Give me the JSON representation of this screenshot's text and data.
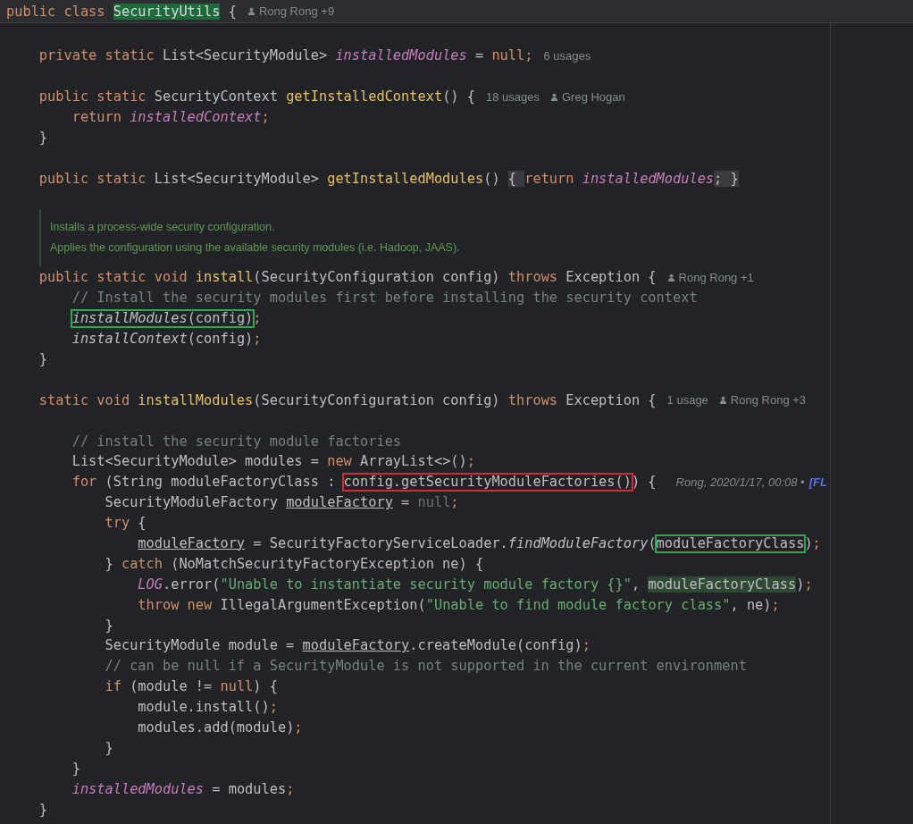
{
  "sticky_header": {
    "tokens": [
      {
        "kind": "kw",
        "text": "public class "
      },
      {
        "kind": "match",
        "text": "SecurityUtils"
      },
      {
        "kind": "plain",
        "text": " {"
      }
    ],
    "hints": [
      {
        "kind": "author",
        "text": "Rong Rong +9"
      }
    ]
  },
  "editor": {
    "blocks": [
      {
        "kind": "blank"
      },
      {
        "kind": "line",
        "tokens": [
          {
            "kind": "kw",
            "text": "    private static "
          },
          {
            "kind": "plain",
            "text": "List<SecurityModule> "
          },
          {
            "kind": "field",
            "text": "installedModules"
          },
          {
            "kind": "plain",
            "text": " = "
          },
          {
            "kind": "kw",
            "text": "null;"
          }
        ],
        "hints": [
          {
            "kind": "usages",
            "text": "6 usages"
          }
        ]
      },
      {
        "kind": "blank"
      },
      {
        "kind": "line",
        "tokens": [
          {
            "kind": "kw",
            "text": "    public static "
          },
          {
            "kind": "plain",
            "text": "SecurityContext "
          },
          {
            "kind": "decl",
            "text": "getInstalledContext"
          },
          {
            "kind": "plain",
            "text": "() {"
          }
        ],
        "hints": [
          {
            "kind": "usages",
            "text": "18 usages"
          },
          {
            "kind": "author",
            "text": "Greg Hogan"
          }
        ]
      },
      {
        "kind": "line",
        "tokens": [
          {
            "kind": "kw",
            "text": "        return "
          },
          {
            "kind": "field",
            "text": "installedContext"
          },
          {
            "kind": "semi",
            "text": ";"
          }
        ]
      },
      {
        "kind": "line",
        "tokens": [
          {
            "kind": "plain",
            "text": "    }"
          }
        ]
      },
      {
        "kind": "blank"
      },
      {
        "kind": "line",
        "tokens": [
          {
            "kind": "kw",
            "text": "    public static "
          },
          {
            "kind": "plain",
            "text": "List<SecurityModule> "
          },
          {
            "kind": "decl",
            "text": "getInstalledModules"
          },
          {
            "kind": "plain",
            "text": "() "
          },
          {
            "kind": "fold",
            "text": "{ "
          },
          {
            "kind": "kw",
            "text": "return "
          },
          {
            "kind": "field",
            "text": "installedModules"
          },
          {
            "kind": "fold",
            "text": "; }"
          }
        ]
      },
      {
        "kind": "blank"
      },
      {
        "kind": "doc",
        "lines": [
          "Installs a process-wide security configuration.",
          "Applies the configuration using the available security modules (i.e. Hadoop, JAAS)."
        ]
      },
      {
        "kind": "line",
        "tokens": [
          {
            "kind": "kw",
            "text": "    public static void "
          },
          {
            "kind": "decl",
            "text": "install"
          },
          {
            "kind": "plain",
            "text": "(SecurityConfiguration config) "
          },
          {
            "kind": "kw",
            "text": "throws "
          },
          {
            "kind": "plain",
            "text": "Exception {"
          }
        ],
        "hints": [
          {
            "kind": "author",
            "text": "Rong Rong +1"
          }
        ]
      },
      {
        "kind": "line",
        "tokens": [
          {
            "kind": "comment",
            "text": "        // Install the security modules first before installing the security context"
          }
        ]
      },
      {
        "kind": "line",
        "tokens": [
          {
            "kind": "boxed",
            "color": "#2fa84f",
            "tokens": [
              {
                "kind": "call",
                "text": "        installModules"
              },
              {
                "kind": "plain",
                "text": "(config)"
              }
            ]
          },
          {
            "kind": "semi",
            "text": ";"
          }
        ]
      },
      {
        "kind": "line",
        "tokens": [
          {
            "kind": "call",
            "text": "        installContext"
          },
          {
            "kind": "plain",
            "text": "(config)"
          },
          {
            "kind": "semi",
            "text": ";"
          }
        ]
      },
      {
        "kind": "line",
        "tokens": [
          {
            "kind": "plain",
            "text": "    }"
          }
        ]
      },
      {
        "kind": "blank"
      },
      {
        "kind": "line",
        "tokens": [
          {
            "kind": "kw",
            "text": "    static void "
          },
          {
            "kind": "decl",
            "text": "installModules"
          },
          {
            "kind": "plain",
            "text": "(SecurityConfiguration config) "
          },
          {
            "kind": "kw",
            "text": "throws "
          },
          {
            "kind": "plain",
            "text": "Exception {"
          }
        ],
        "hints": [
          {
            "kind": "usages",
            "text": "1 usage"
          },
          {
            "kind": "author",
            "text": "Rong Rong +3"
          }
        ]
      },
      {
        "kind": "blank"
      },
      {
        "kind": "line",
        "tokens": [
          {
            "kind": "comment",
            "text": "        // install the security module factories"
          }
        ]
      },
      {
        "kind": "line",
        "tokens": [
          {
            "kind": "plain",
            "text": "        List<SecurityModule> modules = "
          },
          {
            "kind": "kw",
            "text": "new "
          },
          {
            "kind": "plain",
            "text": "ArrayList<>()"
          },
          {
            "kind": "semi",
            "text": ";"
          }
        ]
      },
      {
        "kind": "line",
        "tokens": [
          {
            "kind": "kw",
            "text": "        for "
          },
          {
            "kind": "plain",
            "text": "(String moduleFactoryClass : "
          },
          {
            "kind": "boxed",
            "color": "#e0262c",
            "tokens": [
              {
                "kind": "plain",
                "text": "config.getSecurityModuleFactories()"
              }
            ]
          },
          {
            "kind": "plain",
            "text": ") {"
          }
        ],
        "hints": [
          {
            "kind": "blame",
            "text": "Rong, 2020/1/17, 00:08 •"
          },
          {
            "kind": "link",
            "text": "[FL"
          }
        ]
      },
      {
        "kind": "line",
        "tokens": [
          {
            "kind": "plain",
            "text": "            SecurityModuleFactory "
          },
          {
            "kind": "under",
            "text": "moduleFactory"
          },
          {
            "kind": "plain",
            "text": " = "
          },
          {
            "kind": "dim",
            "text": "null"
          },
          {
            "kind": "semi",
            "text": ";"
          }
        ]
      },
      {
        "kind": "line",
        "tokens": [
          {
            "kind": "kw",
            "text": "            try "
          },
          {
            "kind": "plain",
            "text": "{"
          }
        ]
      },
      {
        "kind": "line",
        "tokens": [
          {
            "kind": "under",
            "text": "                moduleFactory"
          },
          {
            "kind": "plain",
            "text": " = SecurityFactoryServiceLoader."
          },
          {
            "kind": "call",
            "text": "findModuleFactory"
          },
          {
            "kind": "plain",
            "text": "("
          },
          {
            "kind": "boxed",
            "color": "#2fa84f",
            "tokens": [
              {
                "kind": "plain",
                "text": "moduleFactoryClass"
              }
            ]
          },
          {
            "kind": "plain",
            "text": ")"
          },
          {
            "kind": "semi",
            "text": ";"
          }
        ]
      },
      {
        "kind": "line",
        "tokens": [
          {
            "kind": "plain",
            "text": "            } "
          },
          {
            "kind": "kw",
            "text": "catch "
          },
          {
            "kind": "plain",
            "text": "(NoMatchSecurityFactoryException ne) {"
          }
        ]
      },
      {
        "kind": "line",
        "tokens": [
          {
            "kind": "field",
            "text": "                LOG"
          },
          {
            "kind": "plain",
            "text": ".error("
          },
          {
            "kind": "string",
            "text": "\"Unable to instantiate security module factory {}\""
          },
          {
            "kind": "plain",
            "text": ", "
          },
          {
            "kind": "match",
            "text": "moduleFactoryClass"
          },
          {
            "kind": "plain",
            "text": ")"
          },
          {
            "kind": "semi",
            "text": ";"
          }
        ]
      },
      {
        "kind": "line",
        "tokens": [
          {
            "kind": "kw",
            "text": "                throw new "
          },
          {
            "kind": "plain",
            "text": "IllegalArgumentException("
          },
          {
            "kind": "string",
            "text": "\"Unable to find module factory class\""
          },
          {
            "kind": "plain",
            "text": ", ne)"
          },
          {
            "kind": "semi",
            "text": ";"
          }
        ]
      },
      {
        "kind": "line",
        "tokens": [
          {
            "kind": "plain",
            "text": "            }"
          }
        ]
      },
      {
        "kind": "line",
        "tokens": [
          {
            "kind": "plain",
            "text": "            SecurityModule module = "
          },
          {
            "kind": "under",
            "text": "moduleFactory"
          },
          {
            "kind": "plain",
            "text": ".createModule(config)"
          },
          {
            "kind": "semi",
            "text": ";"
          }
        ]
      },
      {
        "kind": "line",
        "tokens": [
          {
            "kind": "comment",
            "text": "            // can be null if a SecurityModule is not supported in the current environment"
          }
        ]
      },
      {
        "kind": "line",
        "tokens": [
          {
            "kind": "kw",
            "text": "            if "
          },
          {
            "kind": "plain",
            "text": "(module != "
          },
          {
            "kind": "kw",
            "text": "null"
          },
          {
            "kind": "plain",
            "text": ") {"
          }
        ]
      },
      {
        "kind": "line",
        "tokens": [
          {
            "kind": "plain",
            "text": "                module.install()"
          },
          {
            "kind": "semi",
            "text": ";"
          }
        ]
      },
      {
        "kind": "line",
        "tokens": [
          {
            "kind": "plain",
            "text": "                modules.add(module)"
          },
          {
            "kind": "semi",
            "text": ";"
          }
        ]
      },
      {
        "kind": "line",
        "tokens": [
          {
            "kind": "plain",
            "text": "            }"
          }
        ]
      },
      {
        "kind": "line",
        "tokens": [
          {
            "kind": "plain",
            "text": "        }"
          }
        ]
      },
      {
        "kind": "line",
        "tokens": [
          {
            "kind": "field",
            "text": "        installedModules"
          },
          {
            "kind": "plain",
            "text": " = modules"
          },
          {
            "kind": "semi",
            "text": ";"
          }
        ]
      },
      {
        "kind": "line",
        "tokens": [
          {
            "kind": "plain",
            "text": "    }"
          }
        ]
      }
    ]
  }
}
